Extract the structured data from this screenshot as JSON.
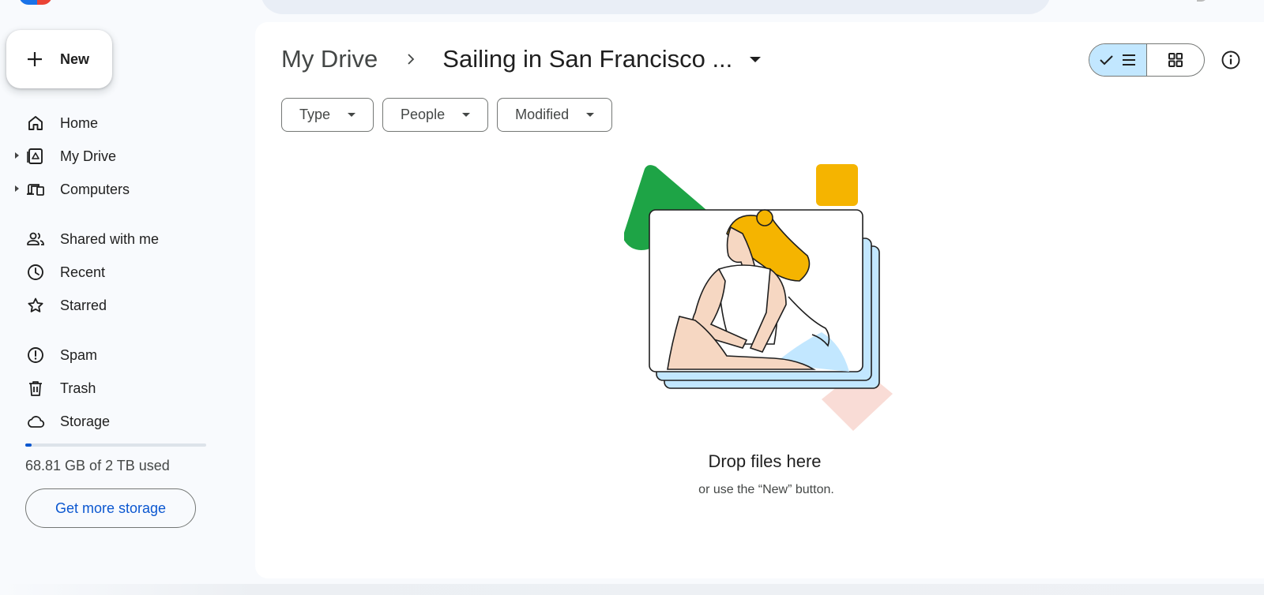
{
  "sidebar": {
    "new_label": "New",
    "items": [
      {
        "label": "Home",
        "icon": "home-icon"
      },
      {
        "label": "My Drive",
        "icon": "my-drive-icon"
      },
      {
        "label": "Computers",
        "icon": "computers-icon"
      },
      {
        "label": "Shared with me",
        "icon": "shared-icon"
      },
      {
        "label": "Recent",
        "icon": "clock-icon"
      },
      {
        "label": "Starred",
        "icon": "star-icon"
      },
      {
        "label": "Spam",
        "icon": "spam-icon"
      },
      {
        "label": "Trash",
        "icon": "trash-icon"
      },
      {
        "label": "Storage",
        "icon": "cloud-icon"
      }
    ],
    "storage": {
      "used_text": "68.81 GB of 2 TB used",
      "used_fraction": 0.034,
      "button_label": "Get more storage"
    }
  },
  "header": {
    "breadcrumb_root": "My Drive",
    "breadcrumb_current": "Sailing in San Francisco ..."
  },
  "filters": [
    {
      "label": "Type"
    },
    {
      "label": "People"
    },
    {
      "label": "Modified"
    }
  ],
  "empty_state": {
    "title": "Drop files here",
    "subtitle": "or use the “New” button."
  },
  "colors": {
    "accent": "#0b57d0",
    "selected_view": "#c2e7ff",
    "triangle": "#1ea446",
    "square": "#f5b400",
    "diamond": "#f9dcd6",
    "card_blue": "#c2e7ff"
  }
}
